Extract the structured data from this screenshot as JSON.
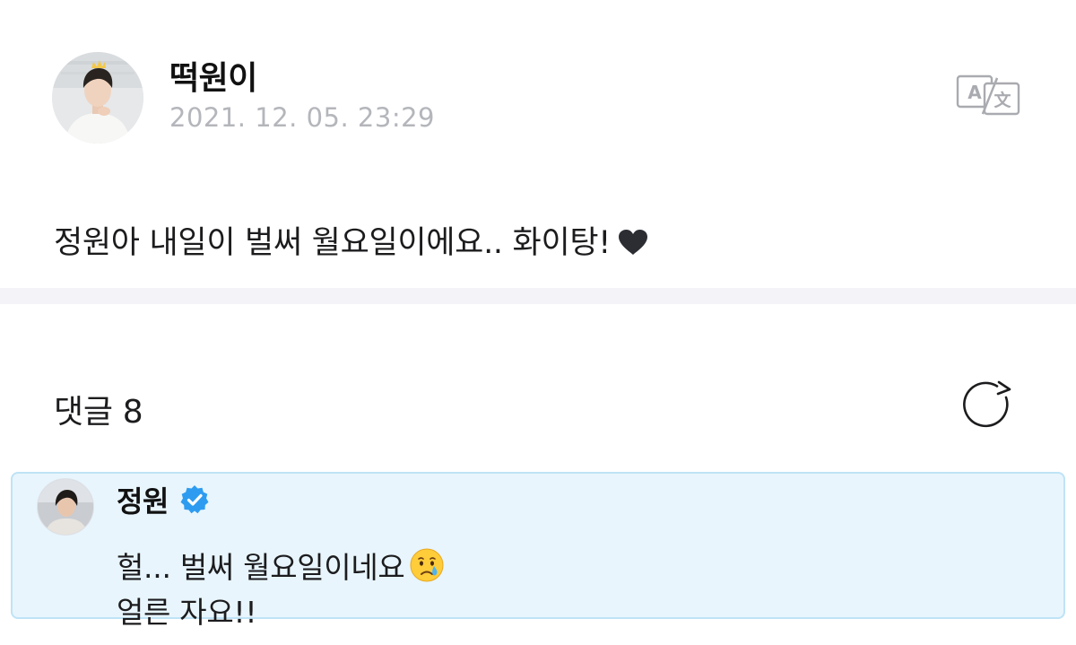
{
  "post": {
    "author_name": "떡원이",
    "timestamp": "2021. 12. 05. 23:29",
    "text": "정원아 내일이 벌써 월요일이에요.. 화이탕!",
    "trailing_icon": "heart-icon",
    "translate_icon": "translate-icon"
  },
  "comments": {
    "label": "댓글",
    "count": "8",
    "refresh_icon": "refresh-icon"
  },
  "highlighted_comment": {
    "author_name": "정원",
    "verified": true,
    "line1": "헐... 벌써 월요일이네요",
    "line1_emoji": "crying-face-emoji",
    "line2": "얼른 자요!!"
  },
  "colors": {
    "card_background": "#e8f5fd",
    "card_border": "#bfe3f6",
    "verified_badge": "#2d9cf0",
    "timestamp": "#b4b6bb",
    "divider": "#f4f4f8"
  }
}
